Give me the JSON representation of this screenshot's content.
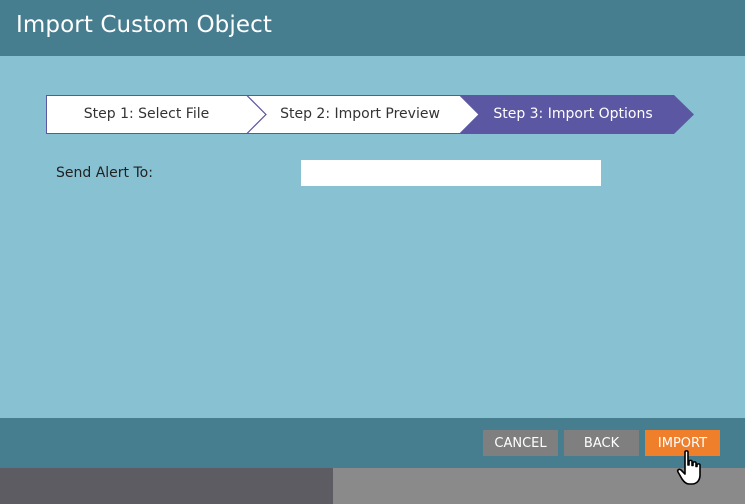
{
  "dialog": {
    "title": "Import Custom Object"
  },
  "steps": [
    {
      "label": "Step 1: Select File",
      "state": "complete"
    },
    {
      "label": "Step 2: Import Preview",
      "state": "complete"
    },
    {
      "label": "Step 3: Import Options",
      "state": "active"
    }
  ],
  "form": {
    "send_alert_label": "Send Alert To:",
    "send_alert_value": ""
  },
  "footer": {
    "cancel_label": "CANCEL",
    "back_label": "BACK",
    "import_label": "IMPORT"
  },
  "colors": {
    "header": "#467d8f",
    "body": "#87c1d2",
    "active_step": "#5b57a3",
    "primary_button": "#f07f2c",
    "secondary_button": "#7f7f7f"
  },
  "icons": {
    "cursor": "hand-pointer-icon"
  }
}
